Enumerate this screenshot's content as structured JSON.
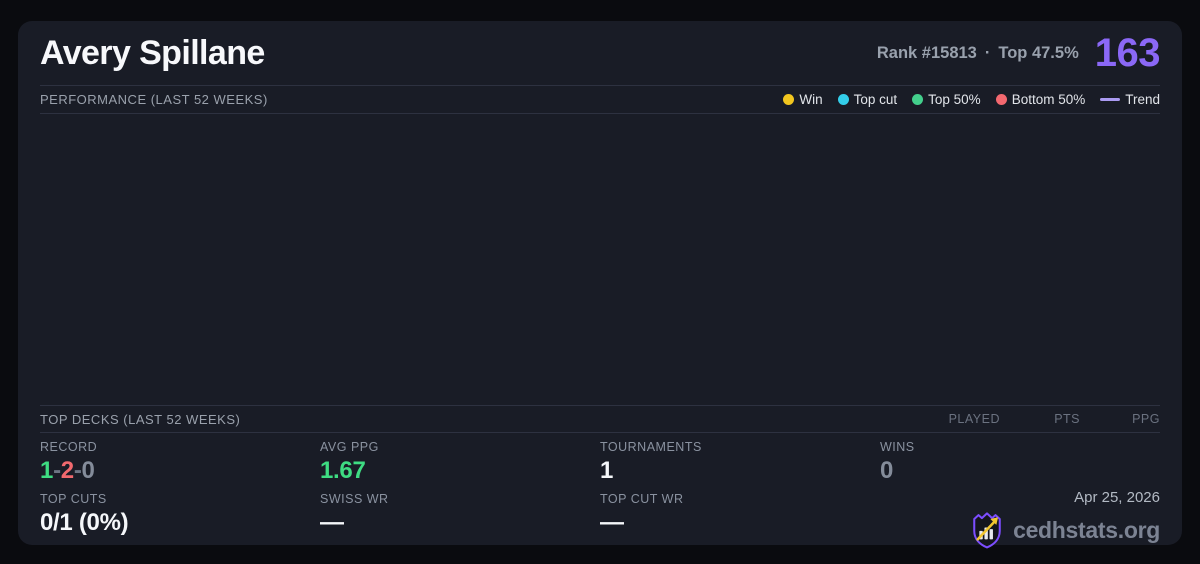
{
  "header": {
    "player_name": "Avery Spillane",
    "rank_text": "Rank #15813",
    "separator": "·",
    "top_percent_text": "Top 47.5%",
    "score": "163"
  },
  "performance": {
    "title": "PERFORMANCE (LAST 52 WEEKS)",
    "legend": [
      {
        "label": "Win",
        "color": "#f2c61f"
      },
      {
        "label": "Top cut",
        "color": "#33ceea"
      },
      {
        "label": "Top 50%",
        "color": "#43cf8c"
      },
      {
        "label": "Bottom 50%",
        "color": "#f3686f"
      },
      {
        "label": "Trend",
        "color": "#ab9bf2"
      }
    ]
  },
  "chart_data": {
    "type": "scatter",
    "title": "PERFORMANCE (LAST 52 WEEKS)",
    "x": [],
    "series": [],
    "legend": [
      "Win",
      "Top cut",
      "Top 50%",
      "Bottom 50%",
      "Trend"
    ],
    "legend_position": "top-right",
    "grid": false,
    "note": "chart plot area is rendered empty - no data points visible"
  },
  "top_decks": {
    "title": "TOP DECKS (LAST 52 WEEKS)",
    "columns": [
      "PLAYED",
      "PTS",
      "PPG"
    ],
    "rows": []
  },
  "stats": {
    "record": {
      "label": "RECORD",
      "wins": "1",
      "losses": "2",
      "draws": "0",
      "sep": "-"
    },
    "avg_ppg": {
      "label": "AVG PPG",
      "value": "1.67"
    },
    "tournaments": {
      "label": "TOURNAMENTS",
      "value": "1"
    },
    "wins": {
      "label": "WINS",
      "value": "0"
    },
    "top_cuts": {
      "label": "TOP CUTS",
      "value": "0/1 (0%)"
    },
    "swiss_wr": {
      "label": "SWISS WR",
      "value": "—"
    },
    "top_cut_wr": {
      "label": "TOP CUT WR",
      "value": "—"
    }
  },
  "footer": {
    "date": "Apr 25, 2026",
    "brand": "cedhstats.org"
  },
  "colors": {
    "page_background": "#0a0b0f",
    "card_background": "#191c26",
    "divider": "#2d3140",
    "accent_purple_score": "#8b68f6",
    "win_yellow": "#f2c61f",
    "top_cut_cyan": "#33ceea",
    "top50_green": "#43cf8c",
    "bottom50_red": "#f3686f",
    "trend_purple": "#ab9bf2",
    "positive_green": "#3edc82",
    "negative_red": "#f1696e",
    "muted_grey": "#848c9a",
    "brand_grey": "#7c8393",
    "logo_purple": "#7c4dff",
    "logo_gold": "#f2c630"
  }
}
